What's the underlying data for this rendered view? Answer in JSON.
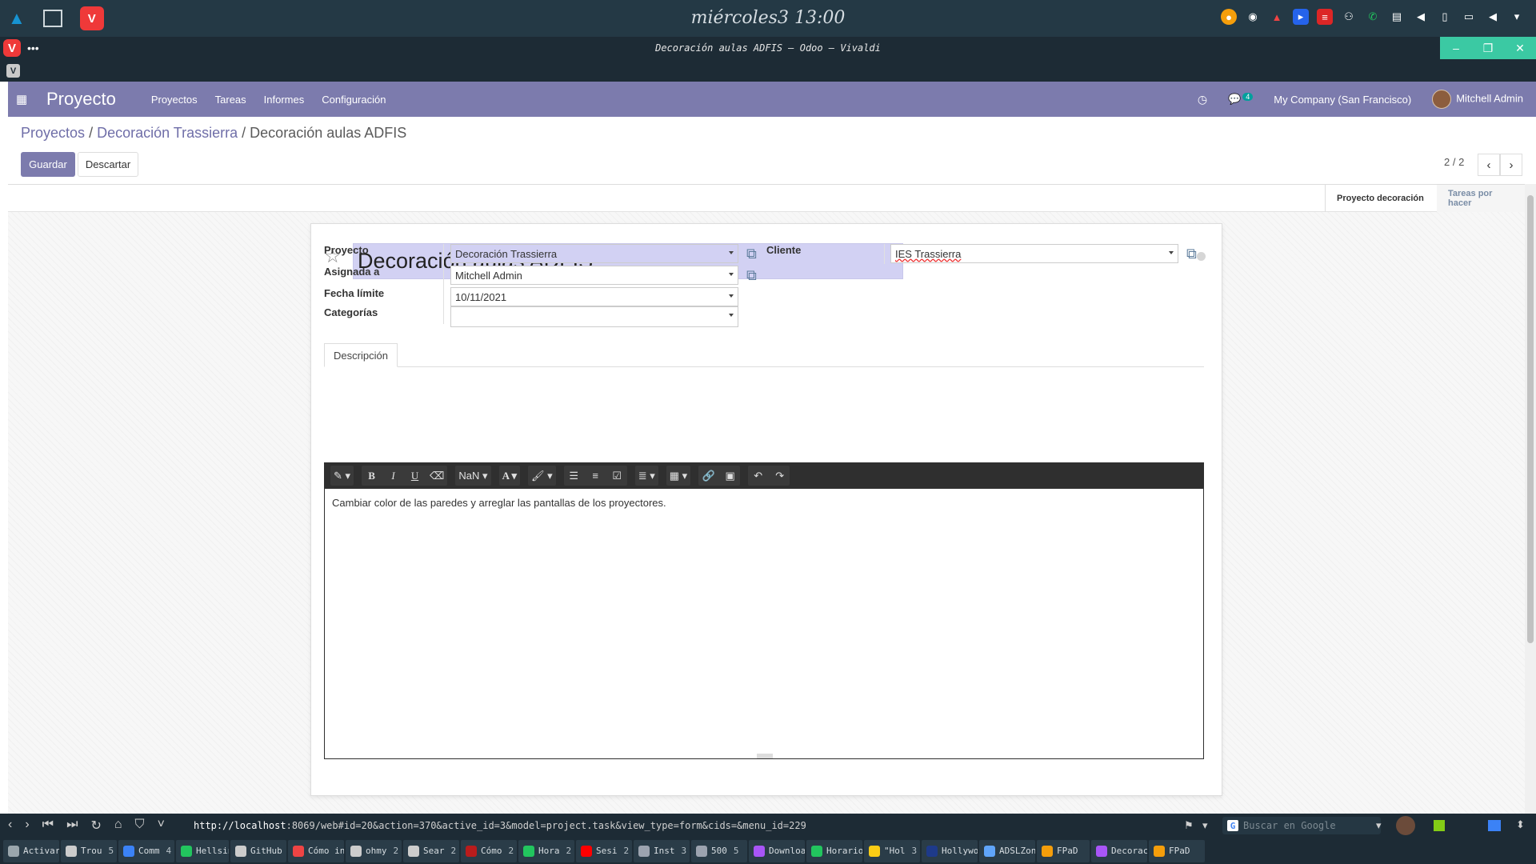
{
  "os": {
    "clock": "miércoles3 13:00",
    "window_title": "Decoración aulas ADFIS – Odoo – Vivaldi",
    "tray_icons": [
      "timer-icon",
      "discord-icon",
      "game-icon",
      "editor-icon",
      "pdf-icon",
      "network-icon",
      "whatsapp-icon",
      "clipboard-icon",
      "volume-icon",
      "battery-icon",
      "display-icon",
      "speaker-icon",
      "menu-icon"
    ]
  },
  "nav": {
    "app_name": "Proyecto",
    "menu": [
      "Proyectos",
      "Tareas",
      "Informes",
      "Configuración"
    ],
    "message_count": "4",
    "company": "My Company (San Francisco)",
    "user": "Mitchell Admin"
  },
  "breadcrumb": {
    "item1": "Proyectos",
    "item2": "Decoración Trassierra",
    "current": "Decoración aulas ADFIS"
  },
  "buttons": {
    "save": "Guardar",
    "discard": "Descartar"
  },
  "pager": {
    "value": "2 / 2"
  },
  "stages": {
    "active": "Proyecto decoración",
    "next": "Tareas por hacer"
  },
  "form": {
    "title": "Decoración aulas ADFIS",
    "labels": {
      "project": "Proyecto",
      "assigned": "Asignada a",
      "deadline": "Fecha límite",
      "categories": "Categorías",
      "customer": "Cliente"
    },
    "values": {
      "project": "Decoración Trassierra",
      "assigned": "Mitchell Admin",
      "deadline": "10/11/2021",
      "categories": "",
      "customer": "IES Trassierra"
    },
    "tab": "Descripción",
    "toolbar": {
      "font_size": "NaN"
    },
    "description": "Cambiar color de las paredes y arreglar las pantallas de los proyectores."
  },
  "browser": {
    "url_host": "http://localhost",
    "url_rest": ":8069/web#id=20&action=370&active_id=3&model=project.task&view_type=form&cids=&menu_id=229",
    "search_placeholder": "Buscar en Google"
  },
  "taskbar": [
    {
      "label": "Activar",
      "count": "",
      "color": "#9aa6ad"
    },
    {
      "label": "Trou",
      "count": "5",
      "color": "#cccccc"
    },
    {
      "label": "Comm",
      "count": "4",
      "color": "#3b82f6"
    },
    {
      "label": "Hellsin",
      "count": "",
      "color": "#22c55e"
    },
    {
      "label": "GitHub",
      "count": "",
      "color": "#cccccc"
    },
    {
      "label": "Cómo in",
      "count": "",
      "color": "#ef4444"
    },
    {
      "label": "ohmy",
      "count": "2",
      "color": "#cccccc"
    },
    {
      "label": "Sear",
      "count": "2",
      "color": "#cccccc"
    },
    {
      "label": "Cómo",
      "count": "2",
      "color": "#b91c1c"
    },
    {
      "label": "Hora",
      "count": "2",
      "color": "#22c55e"
    },
    {
      "label": "Sesi",
      "count": "2",
      "color": "#ff0000"
    },
    {
      "label": "Inst",
      "count": "3",
      "color": "#9ca3af"
    },
    {
      "label": "500",
      "count": "5",
      "color": "#9ca3af"
    },
    {
      "label": "Downloa",
      "count": "",
      "color": "#a855f7"
    },
    {
      "label": "Horario",
      "count": "",
      "color": "#22c55e"
    },
    {
      "label": "\"Hol",
      "count": "3",
      "color": "#facc15"
    },
    {
      "label": "Hollywo",
      "count": "",
      "color": "#1e3a8a"
    },
    {
      "label": "ADSLZon",
      "count": "",
      "color": "#60a5fa"
    },
    {
      "label": "FPaD",
      "count": "",
      "color": "#f59e0b"
    },
    {
      "label": "Decorac",
      "count": "",
      "color": "#a855f7"
    },
    {
      "label": "FPaD",
      "count": "",
      "color": "#f59e0b"
    }
  ]
}
